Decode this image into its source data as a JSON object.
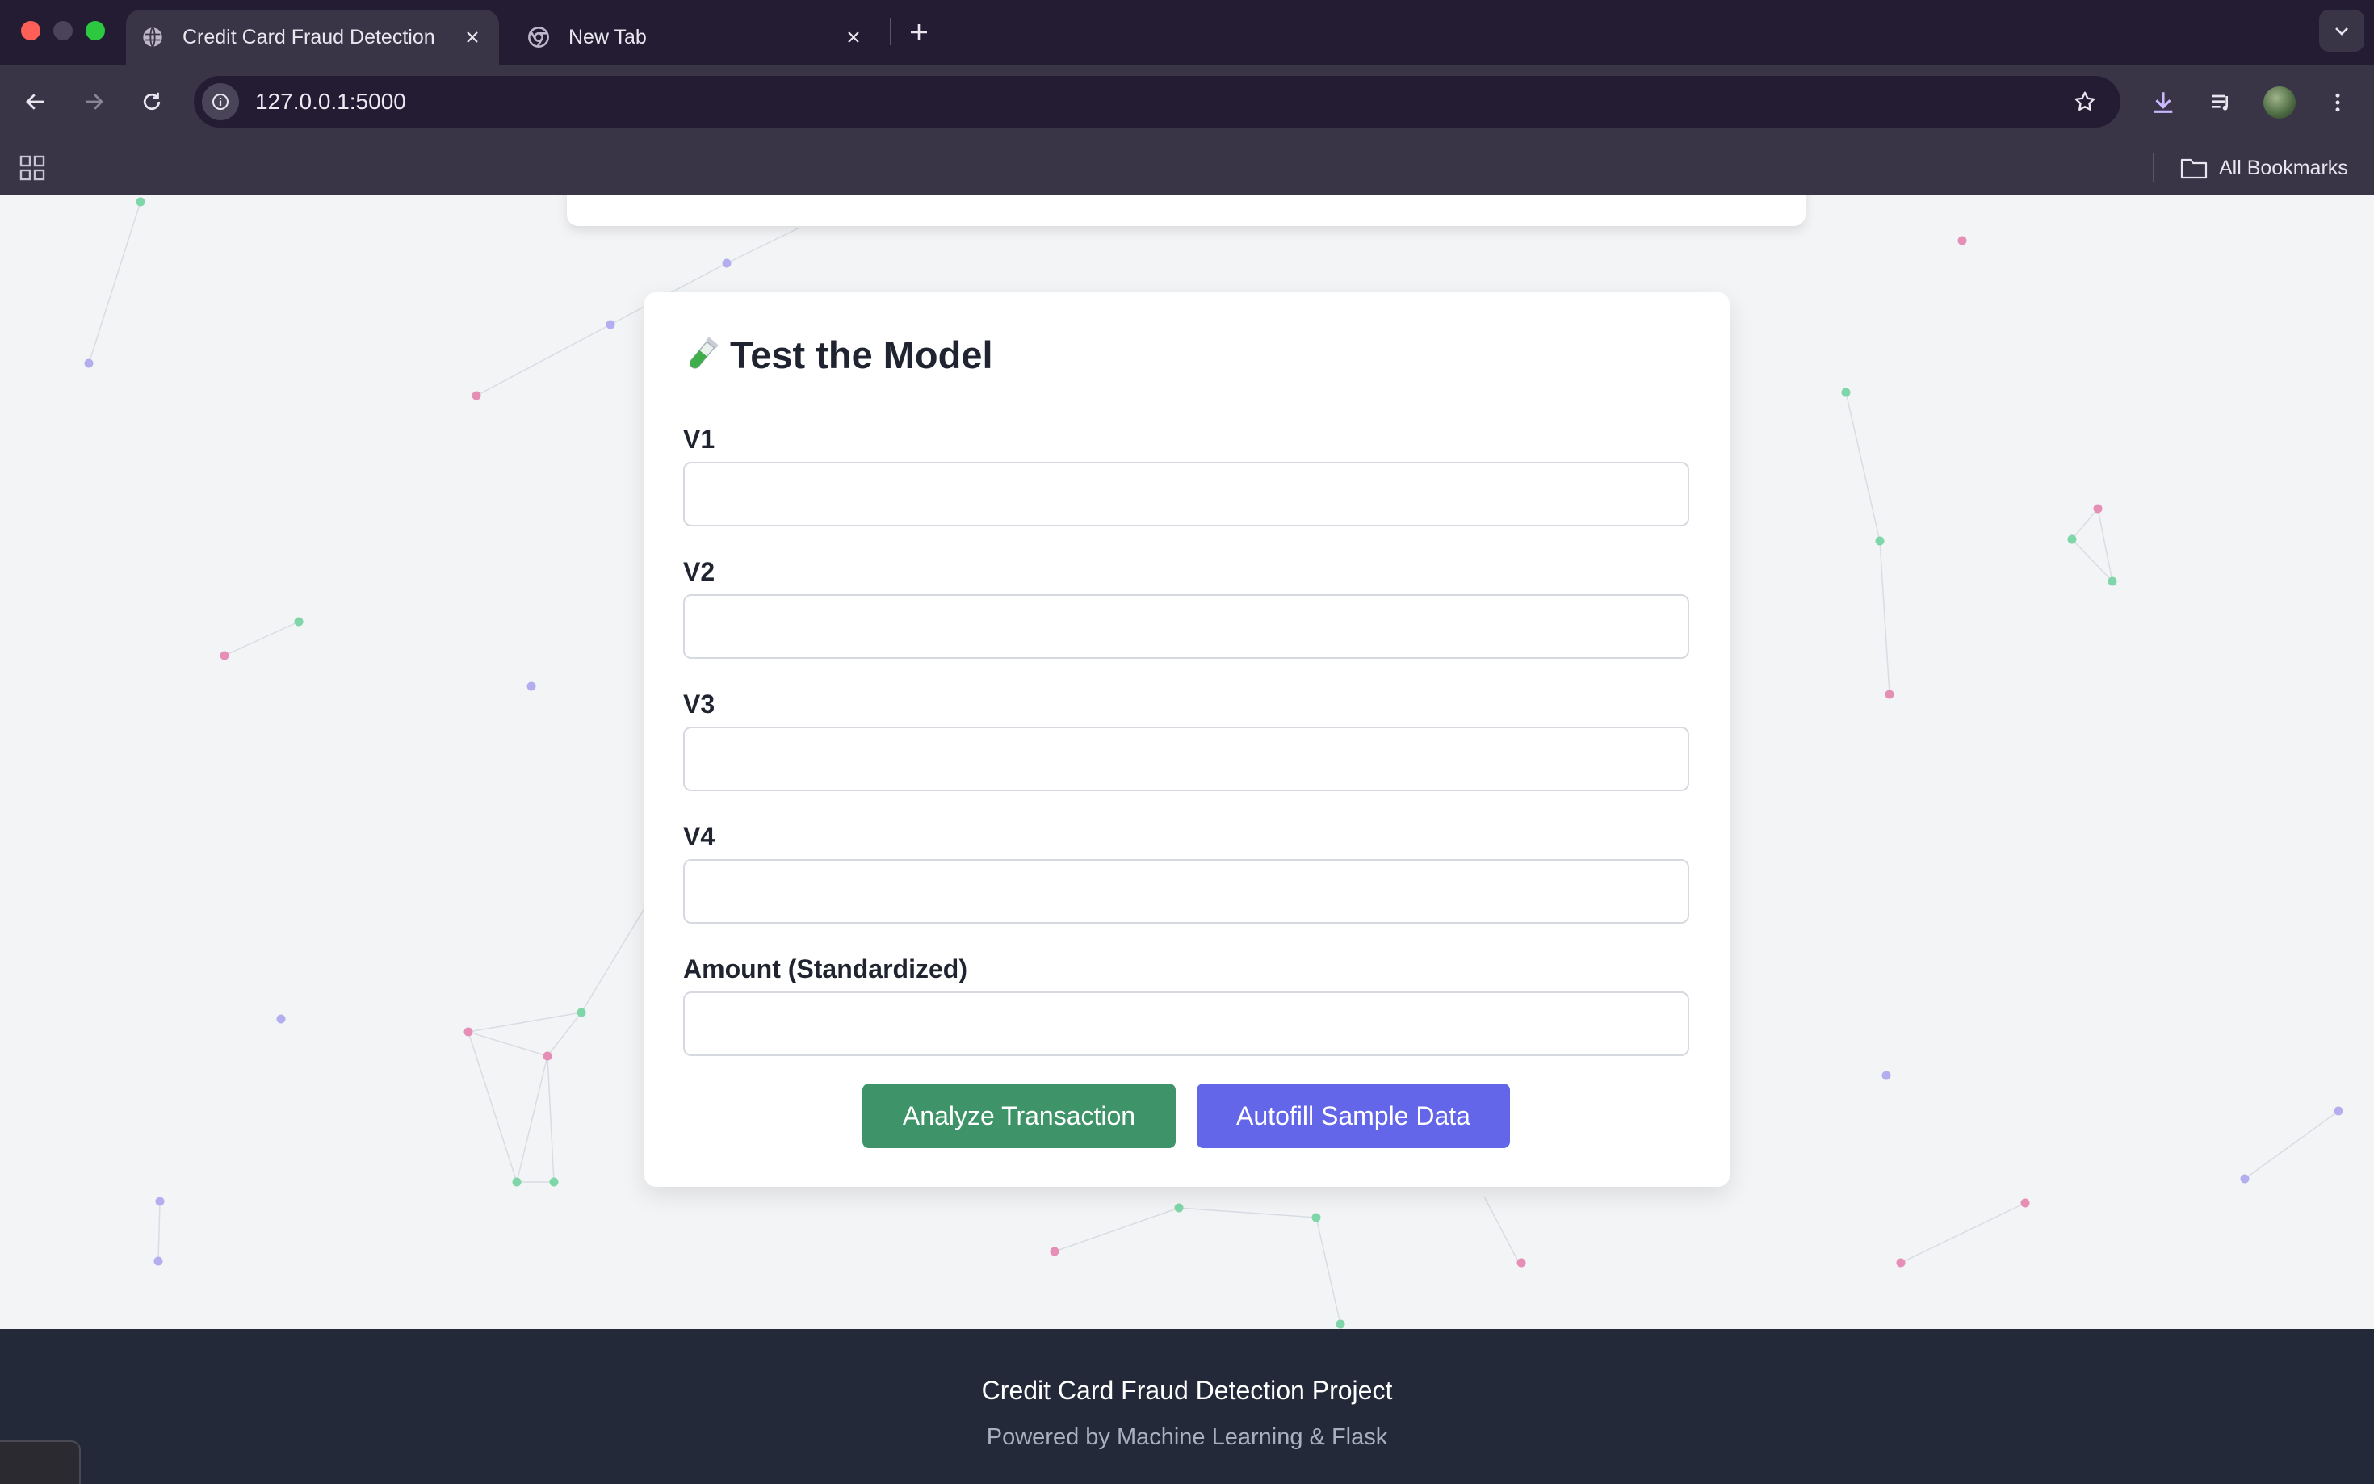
{
  "browser": {
    "tabs": [
      {
        "title": "Credit Card Fraud Detection",
        "active": true
      },
      {
        "title": "New Tab",
        "active": false
      }
    ],
    "address": "127.0.0.1:5000",
    "bookmarks_label": "All Bookmarks"
  },
  "form": {
    "title": "Test the Model",
    "fields": [
      {
        "label": "V1",
        "value": ""
      },
      {
        "label": "V2",
        "value": ""
      },
      {
        "label": "V3",
        "value": ""
      },
      {
        "label": "V4",
        "value": ""
      },
      {
        "label": "Amount (Standardized)",
        "value": ""
      }
    ],
    "analyze_label": "Analyze Transaction",
    "autofill_label": "Autofill Sample Data"
  },
  "footer": {
    "title": "Credit Card Fraud Detection Project",
    "subtitle": "Powered by Machine Learning & Flask"
  },
  "colors": {
    "analyze_button": "#3e9468",
    "autofill_button": "#6366e8",
    "footer_bg": "#232938",
    "page_bg": "#f3f4f6",
    "dot_pink": "#e58fb7",
    "dot_green": "#7fd6a8",
    "dot_purple": "#b4aef0"
  },
  "icons": {
    "title_icon": "test-tube-icon",
    "tab_favicon_1": "globe-icon",
    "tab_favicon_2": "chrome-icon"
  }
}
